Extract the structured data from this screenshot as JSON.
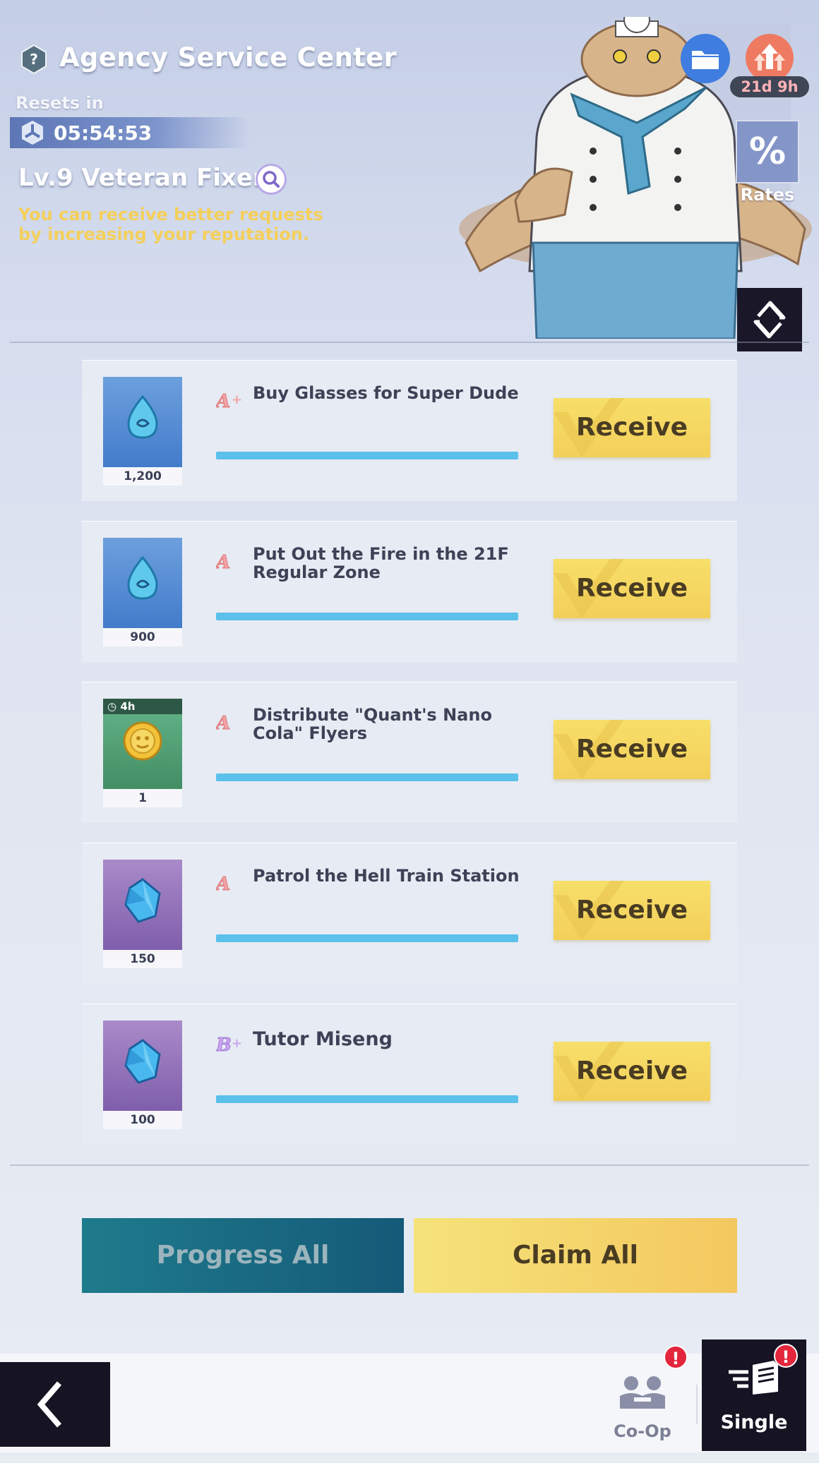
{
  "header": {
    "title": "Agency Service Center",
    "resets_label": "Resets in",
    "reset_timer": "05:54:53",
    "level_title": "Lv.9 Veteran Fixer",
    "hint": "You can receive better requests by increasing your reputation."
  },
  "top_right": {
    "event_timer": "21d 9h",
    "rates_symbol": "%",
    "rates_label": "Rates"
  },
  "requests": [
    {
      "rank": "A+",
      "title": "Buy Glasses for Super Dude",
      "reward_qty": "1,200",
      "reward_icon": "blue-droplet-icon",
      "timer": "",
      "button": "Receive"
    },
    {
      "rank": "A",
      "title": "Put Out the Fire in the 21F Regular Zone",
      "reward_qty": "900",
      "reward_icon": "blue-droplet-icon",
      "timer": "",
      "button": "Receive"
    },
    {
      "rank": "A",
      "title": "Distribute \"Quant's Nano Cola\" Flyers",
      "reward_qty": "1",
      "reward_icon": "gold-coin-icon",
      "timer": "4h",
      "button": "Receive"
    },
    {
      "rank": "A",
      "title": "Patrol the Hell Train Station",
      "reward_qty": "150",
      "reward_icon": "blue-crystal-icon",
      "timer": "",
      "button": "Receive"
    },
    {
      "rank": "B+",
      "title": "Tutor Miseng",
      "reward_qty": "100",
      "reward_icon": "blue-crystal-icon",
      "timer": "",
      "button": "Receive"
    }
  ],
  "actions": {
    "progress_all": "Progress All",
    "claim_all": "Claim All"
  },
  "bottom_nav": {
    "coop_label": "Co-Op",
    "single_label": "Single",
    "alert_mark": "!"
  },
  "colors": {
    "receive_button": "#f4d75f",
    "progress_bar": "#5bc0ea",
    "hint_text": "#f4cf5a",
    "progress_all_button": "#1a6b84",
    "alert_badge": "#e3263d"
  }
}
